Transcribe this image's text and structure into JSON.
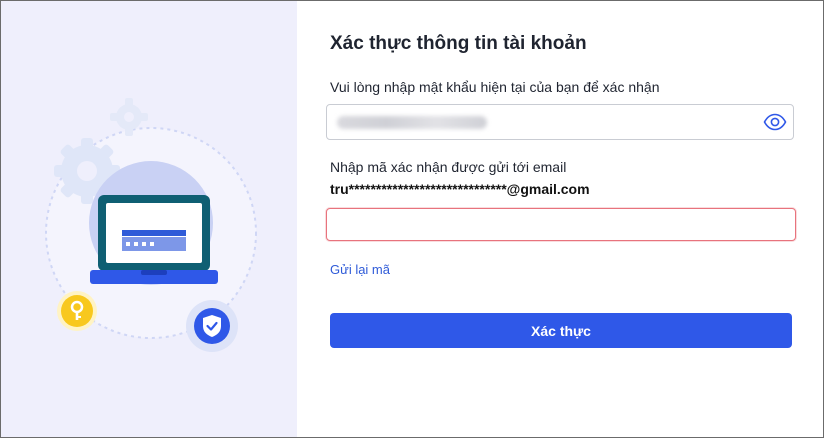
{
  "title": "Xác thực thông tin tài khoản",
  "password": {
    "label": "Vui lòng nhập mật khẩu hiện tại của bạn để xác nhận",
    "toggle_icon": "eye-icon"
  },
  "verification": {
    "label": "Nhập mã xác nhận được gửi tới email",
    "email": "tru*****************************@gmail.com",
    "code_value": "",
    "resend_label": "Gửi lại mã"
  },
  "submit_label": "Xác thực",
  "illustration": {
    "icons": [
      "laptop-icon",
      "gear-icon",
      "key-icon",
      "shield-check-icon"
    ]
  },
  "colors": {
    "accent": "#2f58e8",
    "link": "#2f5bd8",
    "error_border": "#e8737d",
    "panel_bg": "#efeffc"
  }
}
